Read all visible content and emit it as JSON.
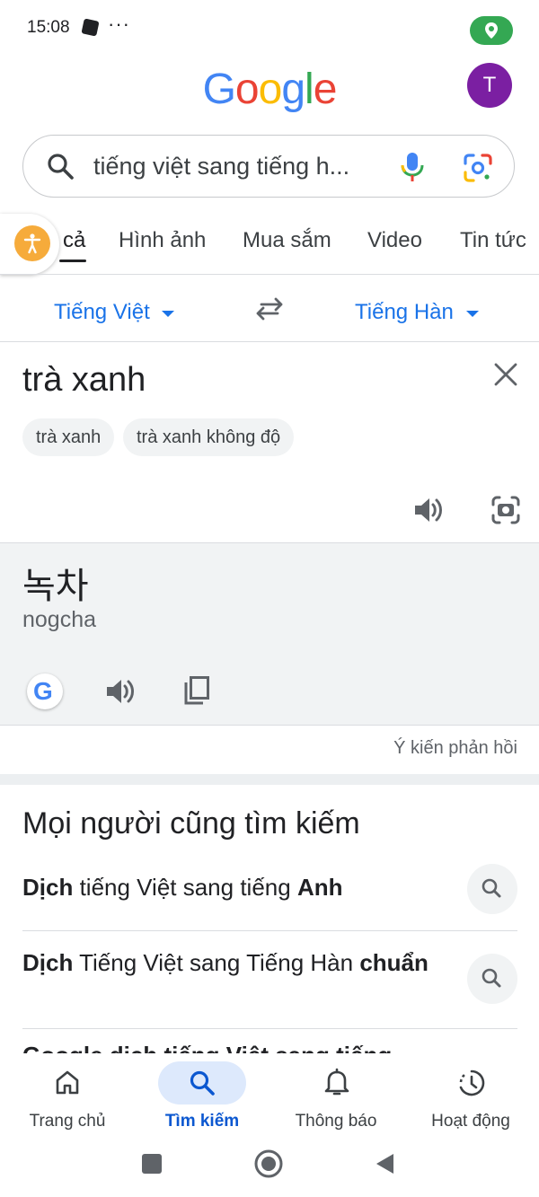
{
  "status_bar": {
    "time": "15:08",
    "dots": "···",
    "location_color": "#34a853"
  },
  "header": {
    "logo_letters": [
      {
        "ch": "G",
        "color": "#4285f4"
      },
      {
        "ch": "o",
        "color": "#ea4335"
      },
      {
        "ch": "o",
        "color": "#fbbc05"
      },
      {
        "ch": "g",
        "color": "#4285f4"
      },
      {
        "ch": "l",
        "color": "#34a853"
      },
      {
        "ch": "e",
        "color": "#ea4335"
      }
    ],
    "avatar_letter": "T",
    "avatar_color": "#7b1fa2"
  },
  "search": {
    "query": "tiếng việt sang tiếng h...",
    "icons": [
      "search-icon",
      "microphone-icon",
      "google-lens-icon"
    ]
  },
  "tabs": [
    {
      "label": "cả",
      "active": true
    },
    {
      "label": "Hình ảnh"
    },
    {
      "label": "Mua sắm"
    },
    {
      "label": "Video"
    },
    {
      "label": "Tin tức"
    }
  ],
  "translator": {
    "source_lang": "Tiếng Việt",
    "target_lang": "Tiếng Hàn",
    "source_text": "trà xanh",
    "suggestions": [
      "trà xanh",
      "trà xanh không độ"
    ],
    "result_text": "녹차",
    "romanization": "nogcha",
    "feedback": "Ý kiến phản hồi",
    "accent_color": "#1a73e8"
  },
  "people_also_search": {
    "title": "Mọi người cũng tìm kiếm",
    "items": [
      {
        "bold1": "Dịch",
        "normal": " tiếng Việt sang tiếng ",
        "bold2": "Anh"
      },
      {
        "bold1": "Dịch",
        "normal": " Tiếng Việt sang Tiếng Hàn ",
        "bold2": "chuẩn"
      }
    ],
    "cut_off_text": "Google dịch tiếng Việt sang tiếng"
  },
  "bottom_nav": [
    {
      "label": "Trang chủ",
      "icon": "home-icon"
    },
    {
      "label": "Tìm kiếm",
      "icon": "search-icon",
      "active": true
    },
    {
      "label": "Thông báo",
      "icon": "bell-icon"
    },
    {
      "label": "Hoạt động",
      "icon": "activity-history-icon"
    }
  ]
}
